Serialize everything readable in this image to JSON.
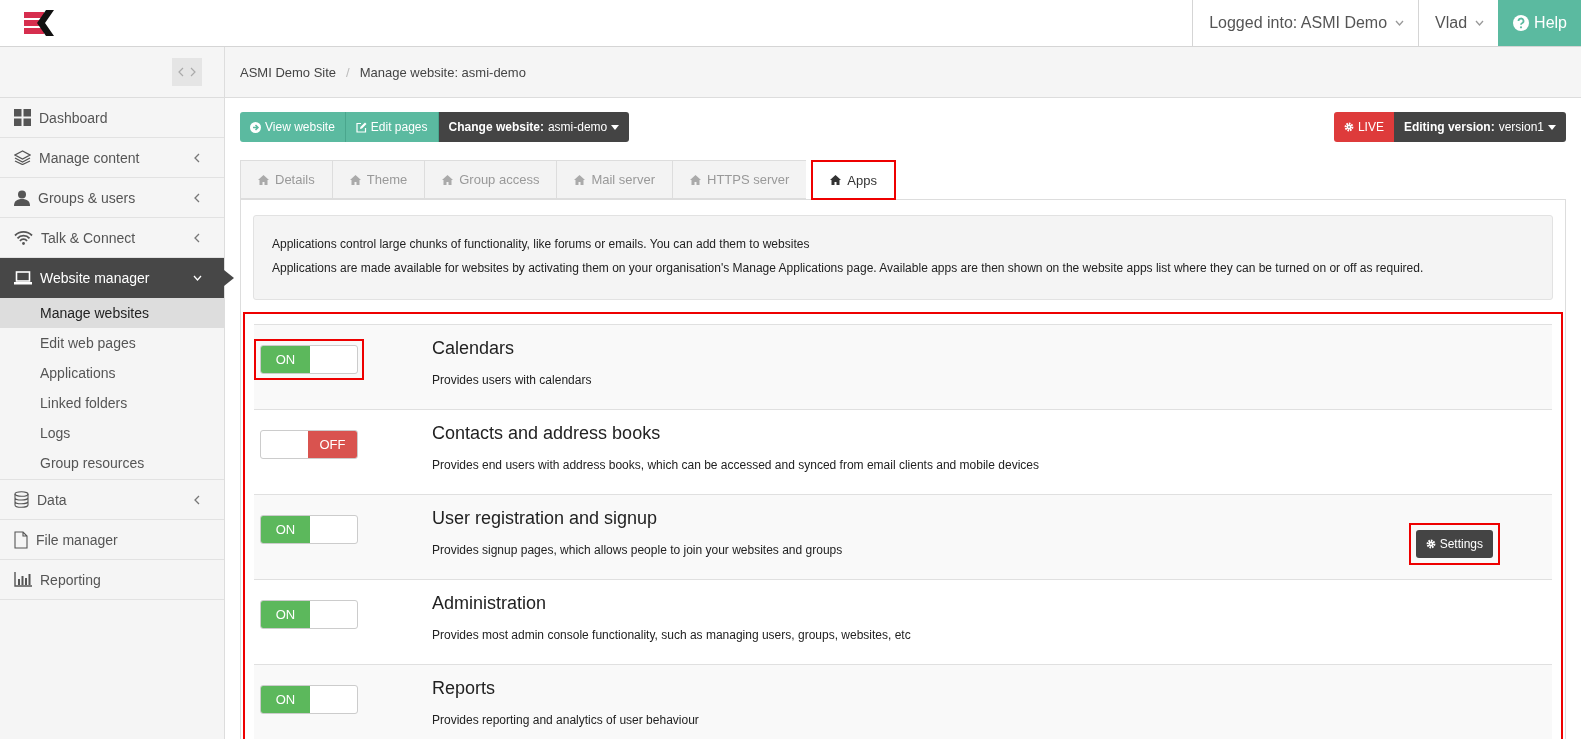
{
  "header": {
    "logged_into": "Logged into: ASMI Demo",
    "user": "Vlad",
    "help": "Help"
  },
  "sidebar": {
    "items": [
      {
        "label": "Dashboard",
        "expandable": false,
        "expanded": false
      },
      {
        "label": "Manage content",
        "expandable": true,
        "expanded": false
      },
      {
        "label": "Groups & users",
        "expandable": true,
        "expanded": false
      },
      {
        "label": "Talk & Connect",
        "expandable": true,
        "expanded": false
      },
      {
        "label": "Website manager",
        "expandable": true,
        "expanded": true,
        "children": [
          {
            "label": "Manage websites",
            "selected": true
          },
          {
            "label": "Edit web pages",
            "selected": false
          },
          {
            "label": "Applications",
            "selected": false
          },
          {
            "label": "Linked folders",
            "selected": false
          },
          {
            "label": "Logs",
            "selected": false
          },
          {
            "label": "Group resources",
            "selected": false
          }
        ]
      },
      {
        "label": "Data",
        "expandable": true,
        "expanded": false
      },
      {
        "label": "File manager",
        "expandable": false,
        "expanded": false
      },
      {
        "label": "Reporting",
        "expandable": false,
        "expanded": false
      }
    ]
  },
  "breadcrumb": [
    "ASMI Demo Site",
    "Manage website: asmi-demo"
  ],
  "breadcrumb_separator": "/",
  "toolbar": {
    "view_website": "View website",
    "edit_pages": "Edit pages",
    "change_website": {
      "label": "Change website:",
      "value": "asmi-demo"
    },
    "live": "LIVE",
    "editing_version": {
      "label": "Editing version:",
      "value": "version1"
    }
  },
  "tabs": [
    {
      "label": "Details",
      "selected": false,
      "highlighted": false
    },
    {
      "label": "Theme",
      "selected": false,
      "highlighted": false
    },
    {
      "label": "Group access",
      "selected": false,
      "highlighted": false
    },
    {
      "label": "Mail server",
      "selected": false,
      "highlighted": false
    },
    {
      "label": "HTTPS server",
      "selected": false,
      "highlighted": false
    },
    {
      "label": "Apps",
      "selected": true,
      "highlighted": true
    }
  ],
  "info": [
    "Applications control large chunks of functionality, like forums or emails. You can add them to websites",
    "Applications are made available for websites by activating them on your organisation's Manage Applications page. Available apps are then shown on the website apps list where they can be turned on or off as required."
  ],
  "apps_highlighted": true,
  "apps": [
    {
      "name": "Calendars",
      "description": "Provides users with calendars",
      "on": true,
      "toggle_label": "ON",
      "toggle_highlighted": true
    },
    {
      "name": "Contacts and address books",
      "description": "Provides end users with address books, which can be accessed and synced from email clients and mobile devices",
      "on": false,
      "toggle_label": "OFF",
      "toggle_highlighted": false
    },
    {
      "name": "User registration and signup",
      "description": "Provides signup pages, which allows people to join your websites and groups",
      "on": true,
      "toggle_label": "ON",
      "toggle_highlighted": false,
      "settings": {
        "label": "Settings",
        "highlighted": true
      }
    },
    {
      "name": "Administration",
      "description": "Provides most admin console functionality, such as managing users, groups, websites, etc",
      "on": true,
      "toggle_label": "ON",
      "toggle_highlighted": false
    },
    {
      "name": "Reports",
      "description": "Provides reporting and analytics of user behaviour",
      "on": true,
      "toggle_label": "ON",
      "toggle_highlighted": false
    }
  ]
}
